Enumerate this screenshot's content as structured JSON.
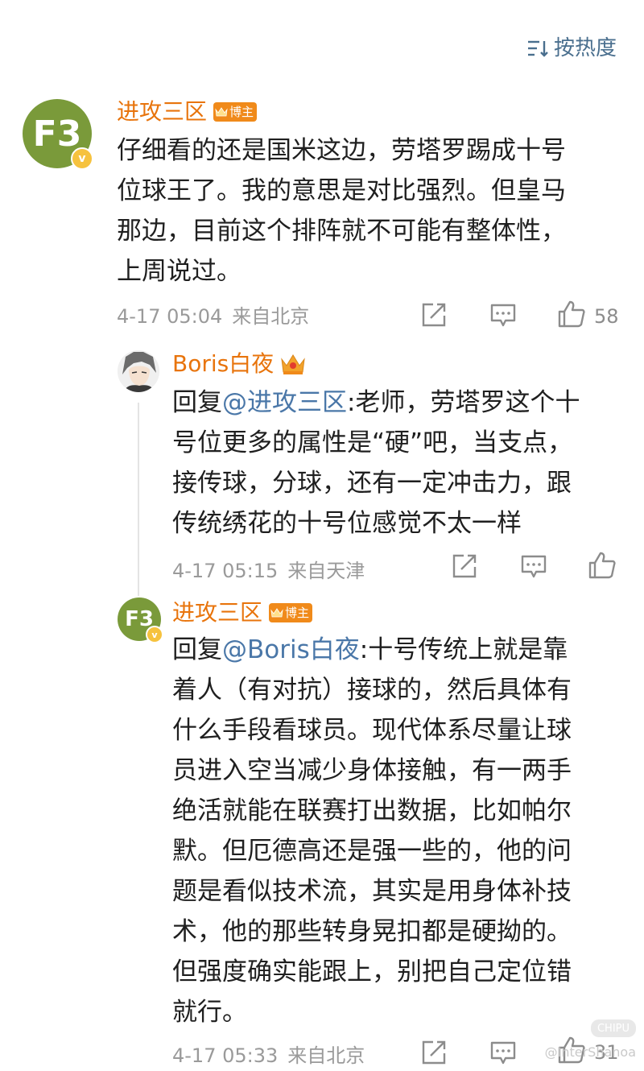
{
  "sort": {
    "label": "按热度",
    "icon": "sort-icon"
  },
  "comments": {
    "main": {
      "avatar_text": "F3",
      "verified_badge": "v",
      "username": "进攻三区",
      "badge": "博主",
      "text": "仔细看的还是国米这边，劳塔罗踢成十号\n位球王了。我的意思是对比强烈。但皇马\n那边，目前这个排阵就不可能有整体性，\n上周说过。",
      "time": "4-17 05:04",
      "location": "来自北京",
      "like_count": "58"
    },
    "reply1": {
      "username": "Boris白夜",
      "prefix": "回复",
      "mention": "@进攻三区",
      "text_line1": ":老师，劳塔罗这个十",
      "text_rest": "号位更多的属性是“硬”吧，当支点，\n接传球，分球，还有一定冲击力，跟\n传统绣花的十号位感觉不太一样",
      "time": "4-17 05:15",
      "location": "来自天津"
    },
    "reply2": {
      "avatar_text": "F3",
      "verified_badge": "v",
      "username": "进攻三区",
      "badge": "博主",
      "prefix": "回复",
      "mention": "@Boris白夜",
      "text_line1": ":十号传统上就是靠",
      "text_rest": "着人（有对抗）接球的，然后具体有\n什么手段看球员。现代体系尽量让球\n员进入空当减少身体接触，有一两手\n绝活就能在联赛打出数据，比如帕尔\n默。但厄德高还是强一些的，他的问\n题是看似技术流，其实是用身体补技\n术，他的那些转身晃扣都是硬拗的。\n但强度确实能跟上，别把自己定位错\n就行。",
      "time": "4-17 05:33",
      "location": "来自北京",
      "like_count": "31"
    }
  },
  "watermark": {
    "text": "@InterShanoa",
    "logo": "CHIPU"
  },
  "colors": {
    "username": "#e8740c",
    "mention": "#4a77a8",
    "meta": "#9a9a9a",
    "sort": "#4a6f8e",
    "badge": "#f08a1a"
  }
}
